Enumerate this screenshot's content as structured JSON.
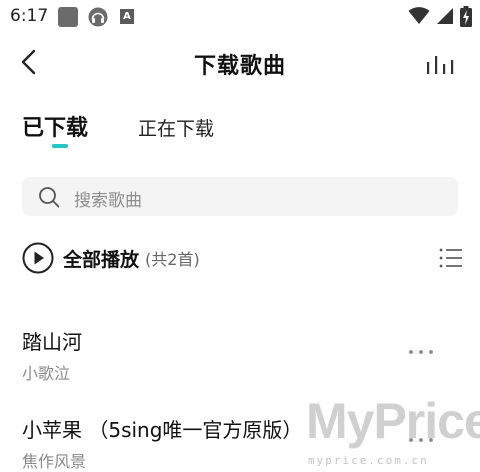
{
  "status_bar": {
    "time": "6:17",
    "icons": [
      "app-square-icon",
      "headset-icon",
      "font-a-icon",
      "wifi-icon",
      "signal-icon",
      "battery-icon"
    ],
    "notification_letter": "A"
  },
  "header": {
    "title": "下载歌曲",
    "back_icon": "chevron-left-icon",
    "equalizer_icon": "equalizer-icon"
  },
  "tabs": [
    {
      "label": "已下载",
      "active": true
    },
    {
      "label": "正在下载",
      "active": false
    }
  ],
  "accent_color": "#22c6c6",
  "search": {
    "placeholder": "搜索歌曲"
  },
  "play_all": {
    "label": "全部播放",
    "count": "(共2首)"
  },
  "songs": [
    {
      "title": "踏山河",
      "artist": "小歌泣"
    },
    {
      "title": "小苹果 （5sing唯一官方原版）",
      "artist": "焦作风景"
    }
  ],
  "watermark": {
    "main": "MyPrice",
    "sub": "myprice.com.cn"
  }
}
